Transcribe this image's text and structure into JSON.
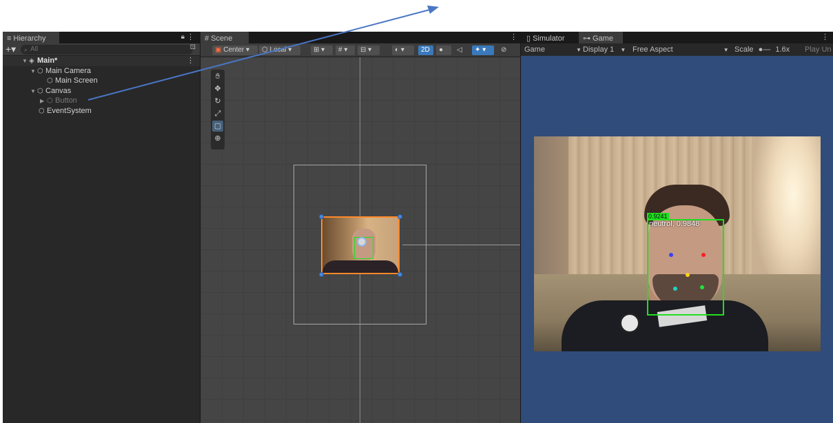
{
  "hierarchy": {
    "tab_label": "Hierarchy",
    "search_placeholder": "All",
    "items": [
      {
        "label": "Main*",
        "level": 0
      },
      {
        "label": "Main Camera",
        "level": 1
      },
      {
        "label": "Main Screen",
        "level": 2
      },
      {
        "label": "Canvas",
        "level": 1
      },
      {
        "label": "Button",
        "level": 2
      },
      {
        "label": "EventSystem",
        "level": 1
      }
    ]
  },
  "scene": {
    "tab_label": "Scene",
    "pivot_label": "Center",
    "space_label": "Local",
    "mode_2d": "2D"
  },
  "game": {
    "simulator_tab": "Simulator",
    "game_tab": "Game",
    "view_mode": "Game",
    "display": "Display 1",
    "aspect": "Free Aspect",
    "scale_label": "Scale",
    "scale_value": "1.6x",
    "play_label": "Play Un",
    "detection": {
      "score_tag": "0.9241",
      "emotion_label": "neutrol, 0.9848"
    }
  },
  "colors": {
    "accent": "#3a79bb",
    "bbox": "#20e020",
    "selection_orange": "#ff8a2a",
    "game_bg": "#2f4c7a"
  }
}
